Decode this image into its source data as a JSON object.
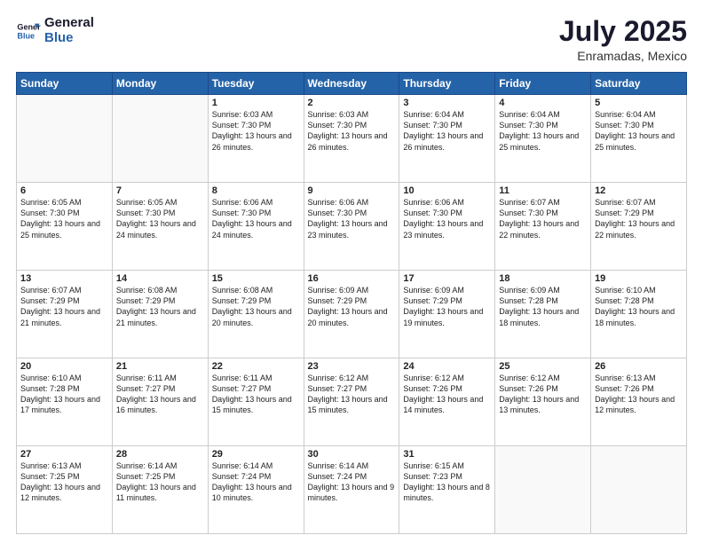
{
  "logo": {
    "line1": "General",
    "line2": "Blue"
  },
  "title": {
    "month_year": "July 2025",
    "location": "Enramadas, Mexico"
  },
  "weekdays": [
    "Sunday",
    "Monday",
    "Tuesday",
    "Wednesday",
    "Thursday",
    "Friday",
    "Saturday"
  ],
  "weeks": [
    [
      {
        "day": "",
        "info": ""
      },
      {
        "day": "",
        "info": ""
      },
      {
        "day": "1",
        "info": "Sunrise: 6:03 AM\nSunset: 7:30 PM\nDaylight: 13 hours and 26 minutes."
      },
      {
        "day": "2",
        "info": "Sunrise: 6:03 AM\nSunset: 7:30 PM\nDaylight: 13 hours and 26 minutes."
      },
      {
        "day": "3",
        "info": "Sunrise: 6:04 AM\nSunset: 7:30 PM\nDaylight: 13 hours and 26 minutes."
      },
      {
        "day": "4",
        "info": "Sunrise: 6:04 AM\nSunset: 7:30 PM\nDaylight: 13 hours and 25 minutes."
      },
      {
        "day": "5",
        "info": "Sunrise: 6:04 AM\nSunset: 7:30 PM\nDaylight: 13 hours and 25 minutes."
      }
    ],
    [
      {
        "day": "6",
        "info": "Sunrise: 6:05 AM\nSunset: 7:30 PM\nDaylight: 13 hours and 25 minutes."
      },
      {
        "day": "7",
        "info": "Sunrise: 6:05 AM\nSunset: 7:30 PM\nDaylight: 13 hours and 24 minutes."
      },
      {
        "day": "8",
        "info": "Sunrise: 6:06 AM\nSunset: 7:30 PM\nDaylight: 13 hours and 24 minutes."
      },
      {
        "day": "9",
        "info": "Sunrise: 6:06 AM\nSunset: 7:30 PM\nDaylight: 13 hours and 23 minutes."
      },
      {
        "day": "10",
        "info": "Sunrise: 6:06 AM\nSunset: 7:30 PM\nDaylight: 13 hours and 23 minutes."
      },
      {
        "day": "11",
        "info": "Sunrise: 6:07 AM\nSunset: 7:30 PM\nDaylight: 13 hours and 22 minutes."
      },
      {
        "day": "12",
        "info": "Sunrise: 6:07 AM\nSunset: 7:29 PM\nDaylight: 13 hours and 22 minutes."
      }
    ],
    [
      {
        "day": "13",
        "info": "Sunrise: 6:07 AM\nSunset: 7:29 PM\nDaylight: 13 hours and 21 minutes."
      },
      {
        "day": "14",
        "info": "Sunrise: 6:08 AM\nSunset: 7:29 PM\nDaylight: 13 hours and 21 minutes."
      },
      {
        "day": "15",
        "info": "Sunrise: 6:08 AM\nSunset: 7:29 PM\nDaylight: 13 hours and 20 minutes."
      },
      {
        "day": "16",
        "info": "Sunrise: 6:09 AM\nSunset: 7:29 PM\nDaylight: 13 hours and 20 minutes."
      },
      {
        "day": "17",
        "info": "Sunrise: 6:09 AM\nSunset: 7:29 PM\nDaylight: 13 hours and 19 minutes."
      },
      {
        "day": "18",
        "info": "Sunrise: 6:09 AM\nSunset: 7:28 PM\nDaylight: 13 hours and 18 minutes."
      },
      {
        "day": "19",
        "info": "Sunrise: 6:10 AM\nSunset: 7:28 PM\nDaylight: 13 hours and 18 minutes."
      }
    ],
    [
      {
        "day": "20",
        "info": "Sunrise: 6:10 AM\nSunset: 7:28 PM\nDaylight: 13 hours and 17 minutes."
      },
      {
        "day": "21",
        "info": "Sunrise: 6:11 AM\nSunset: 7:27 PM\nDaylight: 13 hours and 16 minutes."
      },
      {
        "day": "22",
        "info": "Sunrise: 6:11 AM\nSunset: 7:27 PM\nDaylight: 13 hours and 15 minutes."
      },
      {
        "day": "23",
        "info": "Sunrise: 6:12 AM\nSunset: 7:27 PM\nDaylight: 13 hours and 15 minutes."
      },
      {
        "day": "24",
        "info": "Sunrise: 6:12 AM\nSunset: 7:26 PM\nDaylight: 13 hours and 14 minutes."
      },
      {
        "day": "25",
        "info": "Sunrise: 6:12 AM\nSunset: 7:26 PM\nDaylight: 13 hours and 13 minutes."
      },
      {
        "day": "26",
        "info": "Sunrise: 6:13 AM\nSunset: 7:26 PM\nDaylight: 13 hours and 12 minutes."
      }
    ],
    [
      {
        "day": "27",
        "info": "Sunrise: 6:13 AM\nSunset: 7:25 PM\nDaylight: 13 hours and 12 minutes."
      },
      {
        "day": "28",
        "info": "Sunrise: 6:14 AM\nSunset: 7:25 PM\nDaylight: 13 hours and 11 minutes."
      },
      {
        "day": "29",
        "info": "Sunrise: 6:14 AM\nSunset: 7:24 PM\nDaylight: 13 hours and 10 minutes."
      },
      {
        "day": "30",
        "info": "Sunrise: 6:14 AM\nSunset: 7:24 PM\nDaylight: 13 hours and 9 minutes."
      },
      {
        "day": "31",
        "info": "Sunrise: 6:15 AM\nSunset: 7:23 PM\nDaylight: 13 hours and 8 minutes."
      },
      {
        "day": "",
        "info": ""
      },
      {
        "day": "",
        "info": ""
      }
    ]
  ]
}
